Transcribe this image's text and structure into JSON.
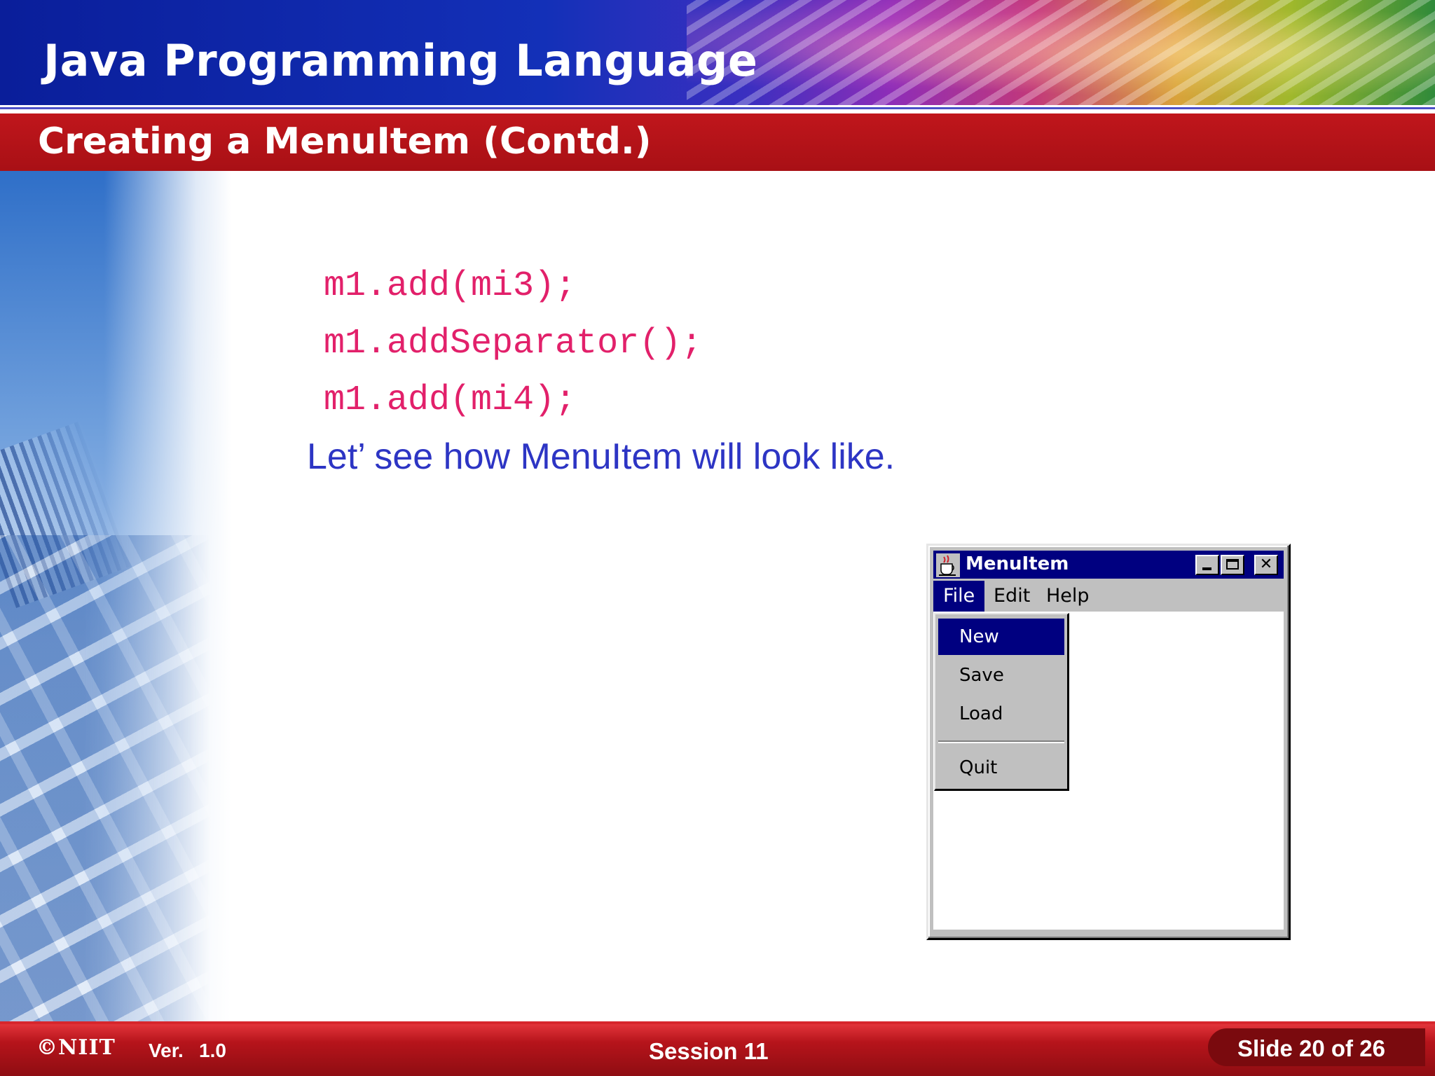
{
  "header": {
    "title": "Java Programming Language",
    "subtitle": "Creating a MenuItem (Contd.)"
  },
  "content": {
    "code_lines": [
      "m1.add(mi3);",
      "m1.addSeparator();",
      "m1.add(mi4);"
    ],
    "caption": "Let’ see how MenuItem will look like."
  },
  "window": {
    "title": "MenuItem",
    "icon": "java-cup-icon",
    "title_buttons": [
      "minimize-icon",
      "maximize-icon",
      "close-icon"
    ],
    "close_glyph": "✕",
    "menus": [
      "File",
      "Edit",
      "Help"
    ],
    "active_menu": "File",
    "file_menu": {
      "items": [
        "New",
        "Save",
        "Load",
        "Quit"
      ],
      "selected": "New",
      "separator_after": "Load"
    }
  },
  "footer": {
    "logo": "©NIIT",
    "version_label": "Ver.",
    "version": "1.0",
    "session": "Session 11",
    "slide": "Slide 20 of 26"
  },
  "colors": {
    "banner_blue": "#1330b8",
    "subtitle_red": "#b3141a",
    "code_pink": "#e2206a",
    "caption_blue": "#2d35c4",
    "window_title_navy": "#000080",
    "window_gray": "#c0c0c0",
    "footer_red": "#b6141b"
  }
}
